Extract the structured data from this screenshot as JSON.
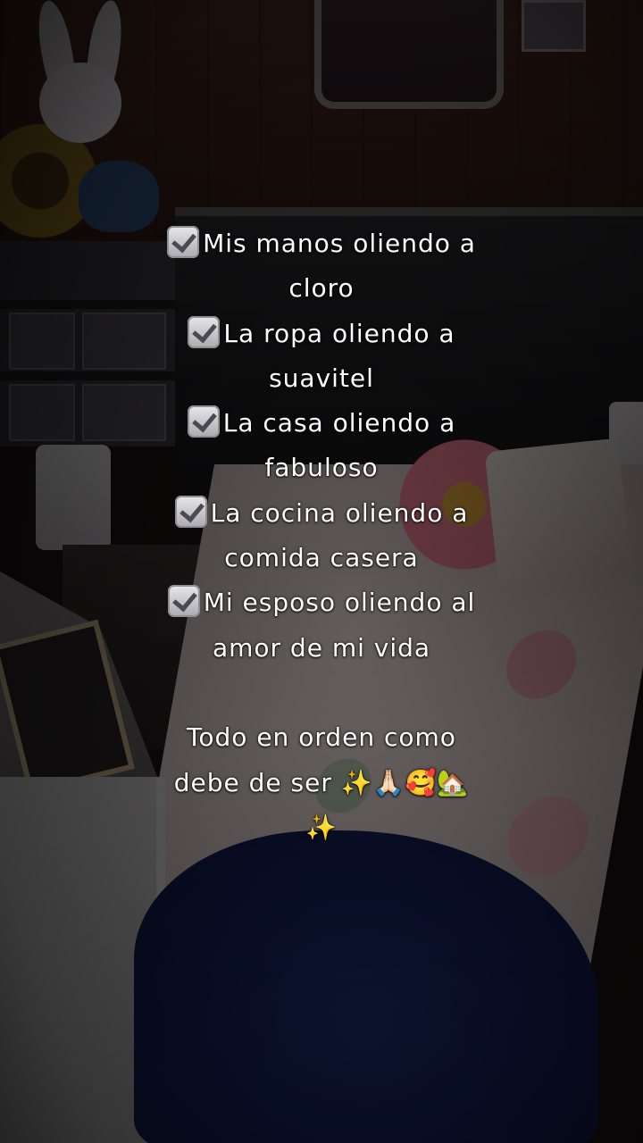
{
  "caption": {
    "items": [
      {
        "line1": "Mis manos oliendo a",
        "line2": "cloro"
      },
      {
        "line1": "La ropa oliendo a",
        "line2": "suavitel"
      },
      {
        "line1": "La casa oliendo a",
        "line2": "fabuloso"
      },
      {
        "line1": "La cocina oliendo a",
        "line2": "comida casera"
      },
      {
        "line1": "Mi esposo oliendo al",
        "line2": "amor de mi vida"
      }
    ],
    "closing_line1": "Todo en orden como",
    "closing_line2": "debe de ser",
    "closing_emojis": "✨🙏🏻🥰🏡",
    "closing_line3": "✨"
  },
  "icons": {
    "checkbox": "check-mark-button-icon"
  }
}
